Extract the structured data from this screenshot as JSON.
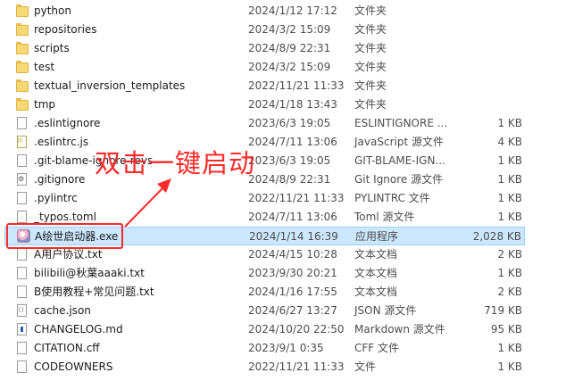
{
  "files": [
    {
      "icon": "folder-icon",
      "name": "python",
      "date": "2024/1/12 17:12",
      "type": "文件夹",
      "size": ""
    },
    {
      "icon": "folder-icon",
      "name": "repositories",
      "date": "2024/3/2 15:09",
      "type": "文件夹",
      "size": ""
    },
    {
      "icon": "folder-icon",
      "name": "scripts",
      "date": "2024/8/9 22:31",
      "type": "文件夹",
      "size": ""
    },
    {
      "icon": "folder-icon",
      "name": "test",
      "date": "2024/3/2 15:09",
      "type": "文件夹",
      "size": ""
    },
    {
      "icon": "folder-icon",
      "name": "textual_inversion_templates",
      "date": "2022/11/21 11:33",
      "type": "文件夹",
      "size": ""
    },
    {
      "icon": "folder-icon",
      "name": "tmp",
      "date": "2024/1/18 13:43",
      "type": "文件夹",
      "size": ""
    },
    {
      "icon": "file-icon",
      "name": ".eslintignore",
      "date": "2023/6/3 19:05",
      "type": "ESLINTIGNORE ...",
      "size": "1 KB"
    },
    {
      "icon": "js-file-icon",
      "name": ".eslintrc.js",
      "date": "2024/7/11 13:06",
      "type": "JavaScript 源文件",
      "size": "4 KB"
    },
    {
      "icon": "file-icon",
      "name": ".git-blame-ignore-revs",
      "date": "2023/6/3 19:05",
      "type": "GIT-BLAME-IGN...",
      "size": "1 KB"
    },
    {
      "icon": "gear-file-icon",
      "name": ".gitignore",
      "date": "2024/8/9 22:31",
      "type": "Git Ignore 源文件",
      "size": "1 KB"
    },
    {
      "icon": "file-icon",
      "name": ".pylintrc",
      "date": "2022/11/21 11:33",
      "type": "PYLINTRC 文件",
      "size": "1 KB"
    },
    {
      "icon": "file-icon",
      "name": "_typos.toml",
      "date": "2024/7/11 13:06",
      "type": "Toml 源文件",
      "size": "1 KB"
    },
    {
      "icon": "exe-icon",
      "name": "A绘世启动器.exe",
      "date": "2024/1/14 16:39",
      "type": "应用程序",
      "size": "2,028 KB",
      "selected": true
    },
    {
      "icon": "file-icon",
      "name": "A用户协议.txt",
      "date": "2024/4/15 10:28",
      "type": "文本文档",
      "size": "2 KB"
    },
    {
      "icon": "file-icon",
      "name": "bilibili@秋葉aaaki.txt",
      "date": "2023/9/30 20:21",
      "type": "文本文档",
      "size": "1 KB"
    },
    {
      "icon": "file-icon",
      "name": "B使用教程+常见问题.txt",
      "date": "2024/1/16 17:55",
      "type": "文本文档",
      "size": "2 KB"
    },
    {
      "icon": "braces-file-icon",
      "name": "cache.json",
      "date": "2024/6/27 13:27",
      "type": "JSON 源文件",
      "size": "719 KB"
    },
    {
      "icon": "md-file-icon",
      "name": "CHANGELOG.md",
      "date": "2024/10/20 22:50",
      "type": "Markdown 源文件",
      "size": "95 KB"
    },
    {
      "icon": "file-icon",
      "name": "CITATION.cff",
      "date": "2023/9/1 0:35",
      "type": "CFF 文件",
      "size": "1 KB"
    },
    {
      "icon": "file-icon",
      "name": "CODEOWNERS",
      "date": "2022/11/21 11:33",
      "type": "文件",
      "size": "1 KB"
    }
  ],
  "annotation": {
    "text": "双击一键启动",
    "color": "#ff2a2a"
  },
  "colors": {
    "selection_bg": "#cce8ff",
    "selection_border": "#99d1ff"
  }
}
